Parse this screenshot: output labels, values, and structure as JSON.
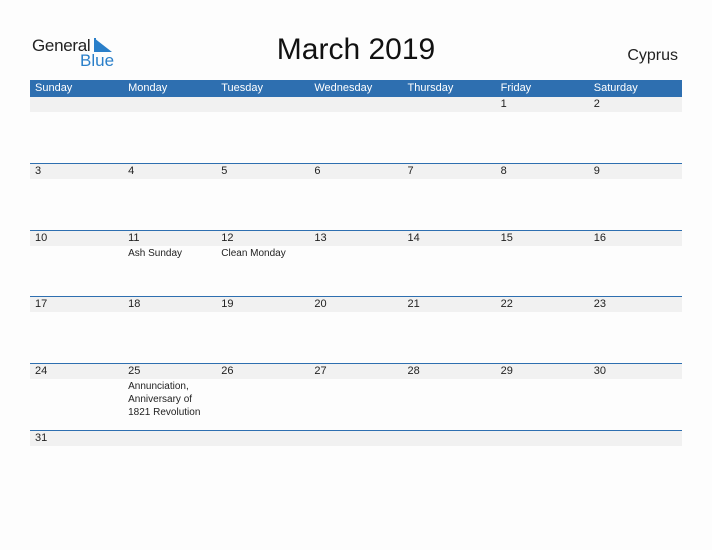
{
  "logo": {
    "word1": "General",
    "word2": "Blue"
  },
  "title": "March 2019",
  "country": "Cyprus",
  "colors": {
    "accent": "#2e6fb0",
    "date_strip": "#f1f1f1",
    "logo_blue": "#2a7fc9"
  },
  "weekdays": [
    "Sunday",
    "Monday",
    "Tuesday",
    "Wednesday",
    "Thursday",
    "Friday",
    "Saturday"
  ],
  "weeks": [
    [
      {
        "day": ""
      },
      {
        "day": ""
      },
      {
        "day": ""
      },
      {
        "day": ""
      },
      {
        "day": ""
      },
      {
        "day": "1"
      },
      {
        "day": "2"
      }
    ],
    [
      {
        "day": "3"
      },
      {
        "day": "4"
      },
      {
        "day": "5"
      },
      {
        "day": "6"
      },
      {
        "day": "7"
      },
      {
        "day": "8"
      },
      {
        "day": "9"
      }
    ],
    [
      {
        "day": "10"
      },
      {
        "day": "11",
        "event": "Ash Sunday"
      },
      {
        "day": "12",
        "event": "Clean Monday"
      },
      {
        "day": "13"
      },
      {
        "day": "14"
      },
      {
        "day": "15"
      },
      {
        "day": "16"
      }
    ],
    [
      {
        "day": "17"
      },
      {
        "day": "18"
      },
      {
        "day": "19"
      },
      {
        "day": "20"
      },
      {
        "day": "21"
      },
      {
        "day": "22"
      },
      {
        "day": "23"
      }
    ],
    [
      {
        "day": "24"
      },
      {
        "day": "25",
        "event": "Annunciation, Anniversary of 1821 Revolution"
      },
      {
        "day": "26"
      },
      {
        "day": "27"
      },
      {
        "day": "28"
      },
      {
        "day": "29"
      },
      {
        "day": "30"
      }
    ],
    [
      {
        "day": "31"
      },
      {
        "day": ""
      },
      {
        "day": ""
      },
      {
        "day": ""
      },
      {
        "day": ""
      },
      {
        "day": ""
      },
      {
        "day": ""
      }
    ]
  ]
}
